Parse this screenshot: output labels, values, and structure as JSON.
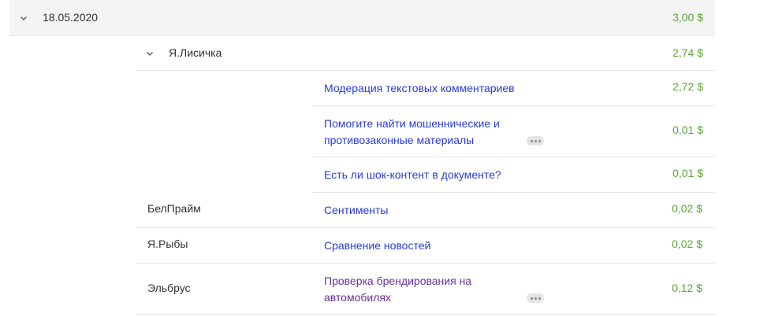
{
  "date_group": {
    "date": "18.05.2020",
    "amount": "3,00 $"
  },
  "project_group": {
    "name": "Я.Лисичка",
    "amount": "2,74 $"
  },
  "project_tasks": [
    {
      "title": "Модерация текстовых комментариев",
      "amount": "2,72 $"
    },
    {
      "title_line1": "Помогите найти мошеннические и",
      "title_line2": "противозаконные материалы",
      "amount": "0,01 $",
      "more": true
    },
    {
      "title": "Есть ли шок-контент в документе?",
      "amount": "0,01 $"
    }
  ],
  "rows": [
    {
      "requester": "БелПрайм",
      "title": "Сентименты",
      "amount": "0,02 $"
    },
    {
      "requester": "Я.Рыбы",
      "title": "Сравнение новостей",
      "amount": "0,02 $"
    },
    {
      "requester": "Эльбрус",
      "title_line1": "Проверка брендирования на",
      "title_line2": "автомобилях",
      "amount": "0,12 $",
      "more": true
    }
  ],
  "icons": {
    "expand": "chevron-down-icon",
    "more": "more-dots-icon"
  },
  "colors": {
    "amount": "#5aa535",
    "link": "#2b3bcf",
    "visited_link": "#6a2f9a",
    "group_bg": "#f4f4f4",
    "divider": "#e6e6e6"
  }
}
